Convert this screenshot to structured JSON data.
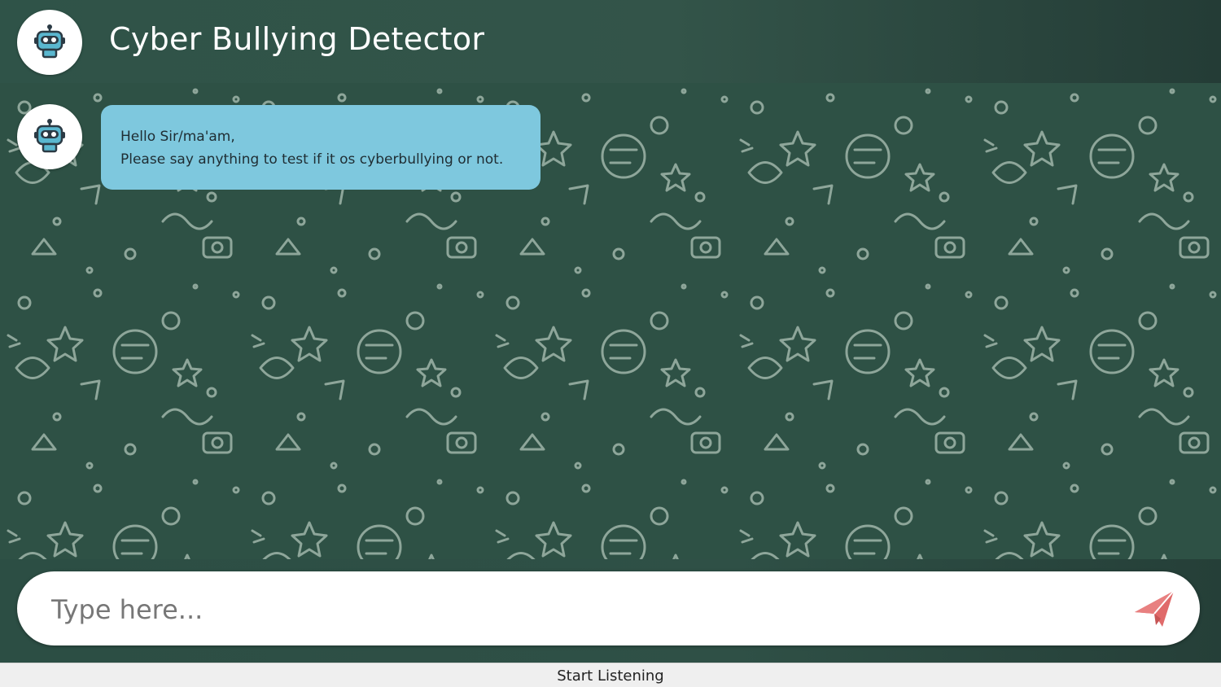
{
  "header": {
    "title": "Cyber Bullying Detector",
    "avatar_icon": "robot-icon"
  },
  "chat": {
    "background_icon": "doodle-pattern",
    "messages": [
      {
        "sender": "bot",
        "avatar_icon": "robot-icon",
        "lines": [
          "Hello Sir/ma'am,",
          "Please say anything to test if it os cyberbullying or not."
        ]
      }
    ]
  },
  "composer": {
    "placeholder": "Type here...",
    "value": "",
    "send_icon": "paper-plane-icon"
  },
  "listen_button": {
    "label": "Start Listening"
  },
  "colors": {
    "header_bg": "#2f5348",
    "chat_bg": "#2e5145",
    "bubble_bg": "#7ec8de",
    "send_icon": "#e06a6a",
    "doodle_stroke": "#9fb5a9"
  }
}
